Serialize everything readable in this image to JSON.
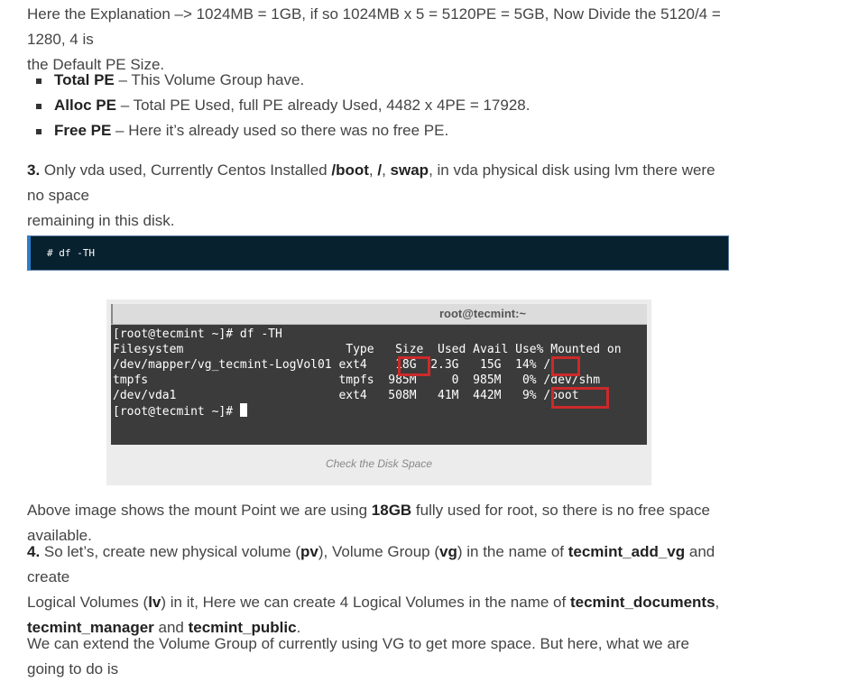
{
  "para1": {
    "text": "Here the Explanation –> 1024MB = 1GB, if so 1024MB x 5 = 5120PE = 5GB, Now Divide the 5120/4 = 1280, 4 is",
    "text2": "the Default PE Size."
  },
  "bullets": [
    {
      "term": "Total PE",
      "desc": " – This Volume Group have."
    },
    {
      "term": "Alloc PE",
      "desc": " – Total PE Used, full PE already Used, 4482 x 4PE = 17928."
    },
    {
      "term": "Free PE",
      "desc": " – Here it’s already used so there was no free PE."
    }
  ],
  "para3": {
    "num": "3.",
    "t1": " Only vda used, Currently Centos Installed ",
    "b1": "/boot",
    "t2": ", ",
    "b2": "/",
    "t3": ", ",
    "b3": "swap",
    "t4": ", in vda physical disk using lvm there were no space",
    "line2": "remaining in this disk."
  },
  "code": {
    "command": "# df -TH"
  },
  "terminal": {
    "title": "root@tecmint:~",
    "lines": [
      "[root@tecmint ~]# df -TH",
      "Filesystem                       Type   Size  Used Avail Use% Mounted on",
      "/dev/mapper/vg_tecmint-LogVol01 ext4    18G  2.3G   15G  14% /",
      "tmpfs                           tmpfs  985M     0  985M   0% /dev/shm",
      "/dev/vda1                       ext4   508M   41M  442M   9% /boot",
      "[root@tecmint ~]# "
    ],
    "caption": "Check the Disk Space"
  },
  "para4": {
    "t1": "Above image shows the mount Point we are using ",
    "b1": "18GB",
    "t2": " fully used for root, so there is no free space available."
  },
  "para5": {
    "num": "4.",
    "t1": " So let’s, create new physical volume (",
    "b1": "pv",
    "t2": "), Volume Group (",
    "b2": "vg",
    "t3": ") in the name of ",
    "b3": "tecmint_add_vg",
    "t4": " and create",
    "t5": "Logical Volumes (",
    "b4": "lv",
    "t6": ") in it, Here we can create 4 Logical Volumes in the name of ",
    "b5": "tecmint_documents",
    "t7": ",",
    "b6": "tecmint_manager",
    "t8": " and ",
    "b7": "tecmint_public",
    "t9": "."
  },
  "para6": {
    "text": "We can extend the Volume Group of currently using VG to get more space. But here, what we are going to do is"
  },
  "colors": {
    "code_bg": "#07212f",
    "code_accent": "#2b7dc8",
    "terminal_bg": "#3b3b3b",
    "highlight": "#cc2a2a"
  }
}
